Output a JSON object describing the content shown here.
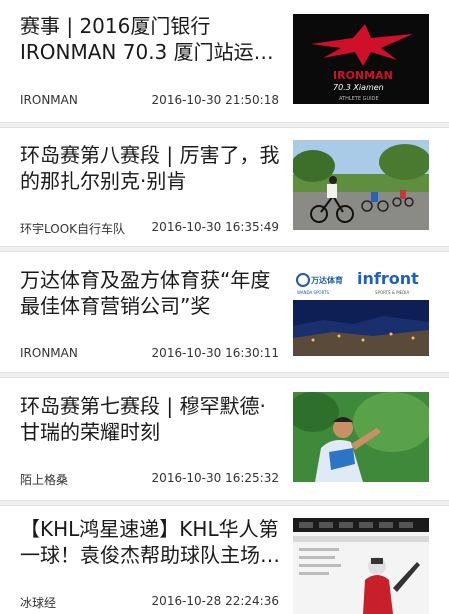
{
  "articles": [
    {
      "title": "赛事 | 2016厦门银行IRONMAN 70.3 厦门站运动…",
      "source": "IRONMAN",
      "time": "2016-10-30 21:50:18",
      "thumb": {
        "icon": "ironman-logo",
        "lines": [
          "IRONMAN",
          "70.3 Xiamen",
          "ATHLETE GUIDE"
        ]
      }
    },
    {
      "title": "环岛赛第八赛段 | 厉害了，我的那扎尔别克·别肯",
      "source": "环宇LOOK自行车队",
      "time": "2016-10-30 16:35:49",
      "thumb": {
        "icon": "cyclists-photo"
      }
    },
    {
      "title": "万达体育及盈方体育获“年度最佳体育营销公司”奖",
      "source": "IRONMAN",
      "time": "2016-10-30 16:30:11",
      "thumb": {
        "icon": "wanda-infront-logos",
        "lines": [
          "万达体育",
          "WANDA SPORTS",
          "infront",
          "SPORTS & MEDIA"
        ]
      }
    },
    {
      "title": "环岛赛第七赛段 | 穆罕默德·甘瑞的荣耀时刻",
      "source": "陌上格桑",
      "time": "2016-10-30 16:25:32",
      "thumb": {
        "icon": "cyclist-portrait-photo"
      }
    },
    {
      "title": "【KHL鸿星速递】KHL华人第一球！袁俊杰帮助球队主场…",
      "source": "冰球经",
      "time": "2016-10-28 22:24:36",
      "thumb": {
        "icon": "hockey-player-photo"
      }
    }
  ],
  "colors": {
    "ironman_red": "#d0102a",
    "separator": "#efefef",
    "text": "#1a1a1a"
  }
}
